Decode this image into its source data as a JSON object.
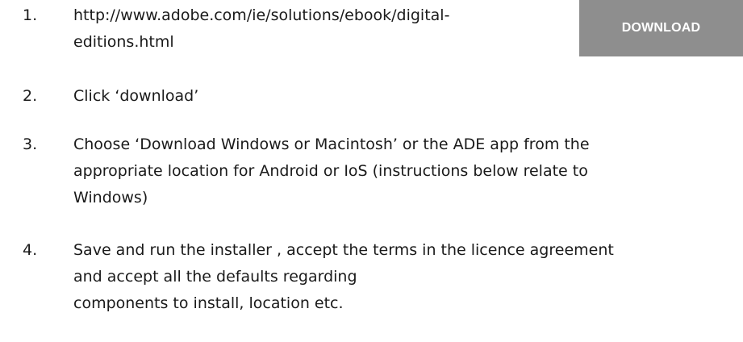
{
  "download_button": {
    "label": "DOWNLOAD"
  },
  "steps": [
    {
      "number": "1.",
      "lines": [
        "http://www.adobe.com/ie/solutions/ebook/digital-",
        "editions.html"
      ]
    },
    {
      "number": "2.",
      "lines": [
        "Click ‘download’"
      ]
    },
    {
      "number": "3.",
      "lines": [
        "Choose  ‘Download Windows or Macintosh’ or the ADE app from the",
        "appropriate location for Android or IoS (instructions below relate to",
        "Windows)"
      ]
    },
    {
      "number": "4.",
      "lines": [
        "Save and run the installer , accept the terms in the licence agreement",
        "and accept all the defaults regarding",
        "components to install, location etc."
      ]
    }
  ]
}
